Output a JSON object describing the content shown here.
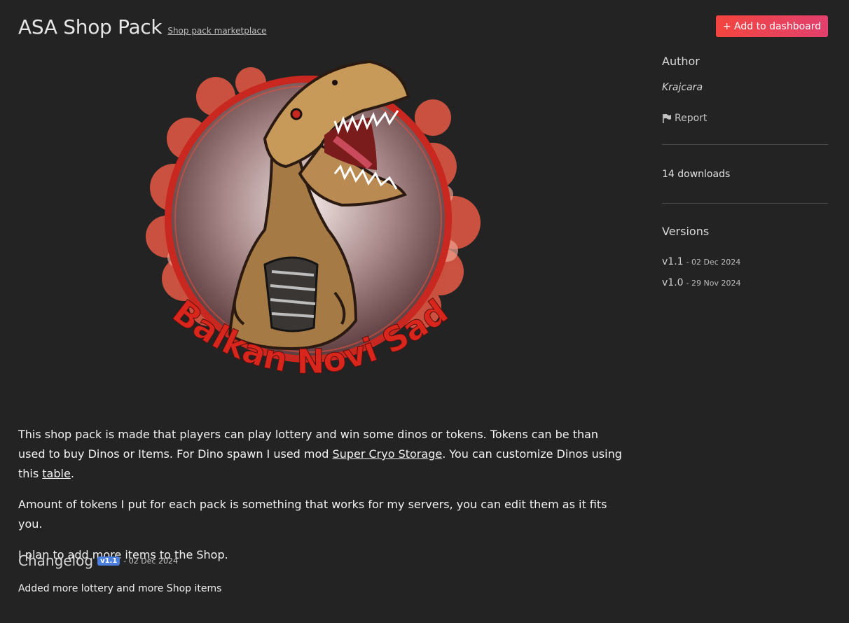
{
  "header": {
    "title": "ASA Shop Pack",
    "subtitle_link": "Shop pack marketplace",
    "add_button": "+ Add to dashboard"
  },
  "logo": {
    "text": "Balkan Novi Sad",
    "colors": {
      "ring": "#c8281f",
      "smoke": "#e85a45",
      "text": "#d9261c",
      "dino_skin": "#b8864a"
    }
  },
  "description": {
    "p1_before": "This shop pack is made that players can play lottery and win some dinos or tokens. Tokens can be than used to buy Dinos or Items. For Dino spawn I used mod ",
    "p1_link1": "Super Cryo Storage",
    "p1_middle": ". You can customize Dinos using this ",
    "p1_link2": "table",
    "p1_end": ".",
    "p2": "Amount of tokens I put for each pack is something that works for my servers, you can edit them as it fits you.",
    "p3": "I plan to add more items to the Shop."
  },
  "changelog": {
    "title": "Changelog",
    "badge": "v1.1",
    "date": "- 02 Dec 2024",
    "text": "Added more lottery and more Shop items"
  },
  "sidebar": {
    "author_heading": "Author",
    "author_name": "Krajcara",
    "report_label": "Report",
    "report_icon": "flag-icon",
    "downloads": "14 downloads",
    "versions_heading": "Versions",
    "versions": [
      {
        "label": "v1.1",
        "date": "- 02 Dec 2024"
      },
      {
        "label": "v1.0",
        "date": "- 29 Nov 2024"
      }
    ]
  },
  "colors": {
    "background": "#232323",
    "accent_start": "#f2453f",
    "accent_end": "#e2406e",
    "badge": "#4a7fe0"
  }
}
